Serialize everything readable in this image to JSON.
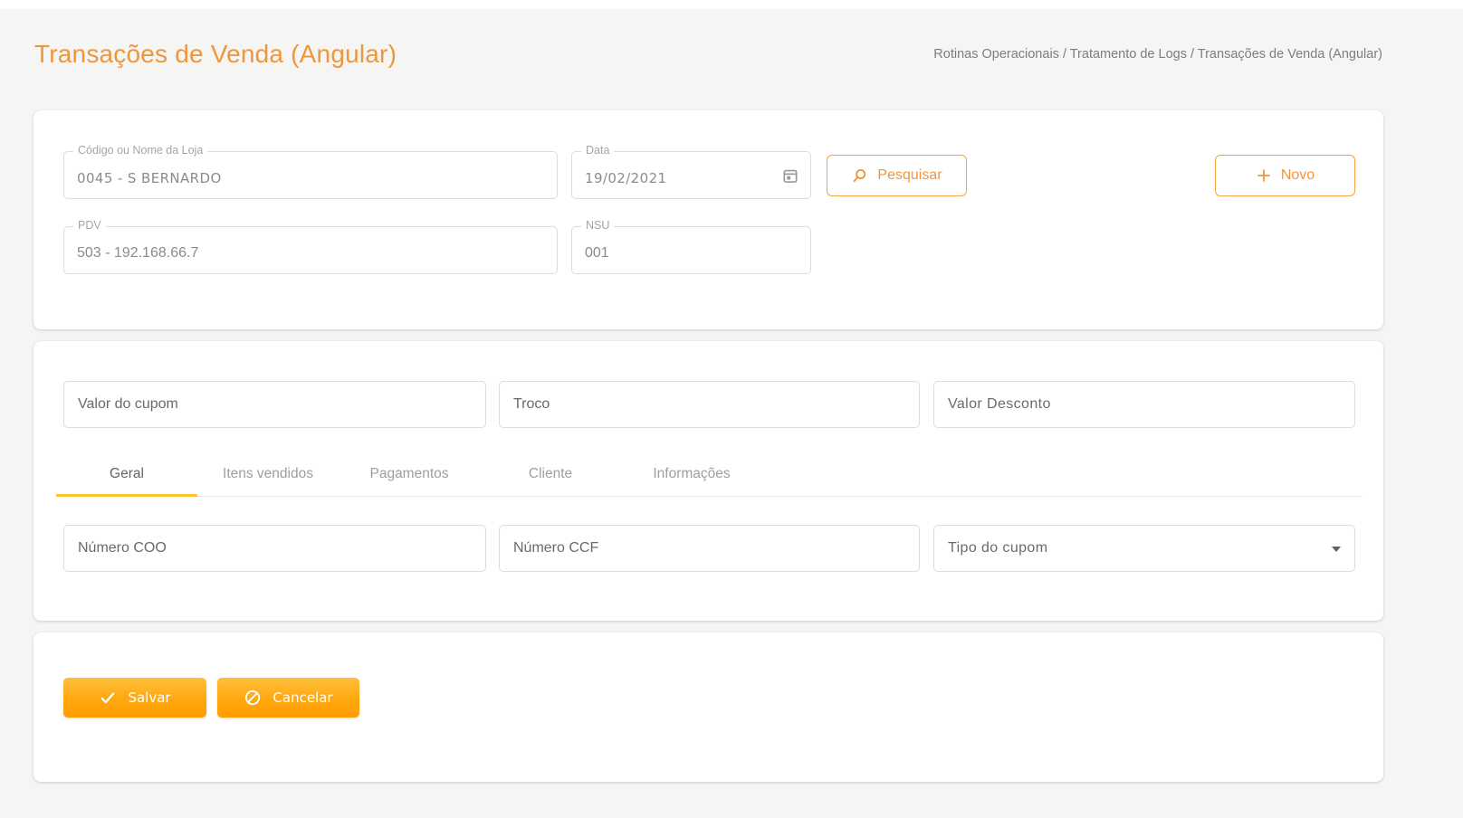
{
  "page": {
    "title": "Transações de Venda (Angular)",
    "breadcrumb": "Rotinas Operacionais / Tratamento de Logs / Transações de Venda (Angular)"
  },
  "search_card": {
    "fields": {
      "store": {
        "label": "Código ou Nome da Loja",
        "value": "0045 - S BERNARDO"
      },
      "date": {
        "label": "Data",
        "value": "19/02/2021",
        "icon": "calendar-icon"
      },
      "pdv": {
        "label": "PDV",
        "value": "503 - 192.168.66.7"
      },
      "nsu": {
        "label": "NSU",
        "value": "001"
      }
    },
    "buttons": {
      "search": {
        "label": "Pesquisar",
        "icon": "search-icon"
      },
      "new": {
        "label": "Novo",
        "icon": "plus-icon"
      }
    }
  },
  "details_card": {
    "fields": {
      "coupon_value": {
        "placeholder": "Valor do cupom"
      },
      "change": {
        "placeholder": "Troco"
      },
      "discount_value": {
        "placeholder": "Valor Desconto"
      },
      "coo_number": {
        "placeholder": "Número COO"
      },
      "ccf_number": {
        "placeholder": "Número CCF"
      },
      "coupon_type": {
        "placeholder": "Tipo do cupom",
        "icon": "caret-down-icon"
      }
    },
    "tabs": [
      {
        "label": "Geral",
        "active": true
      },
      {
        "label": "Itens vendidos",
        "active": false
      },
      {
        "label": "Pagamentos",
        "active": false
      },
      {
        "label": "Cliente",
        "active": false
      },
      {
        "label": "Informações",
        "active": false
      }
    ]
  },
  "actions_card": {
    "save": {
      "label": "Salvar",
      "icon": "check-icon"
    },
    "cancel": {
      "label": "Cancelar",
      "icon": "block-icon"
    }
  },
  "colors": {
    "accent_orange": "#f0963a",
    "outline_button_border": "#f2a43f",
    "tab_underline": "#fdc331",
    "fill_button_top": "#ffbf3d",
    "fill_button_bottom": "#ff9d00",
    "page_background": "#f5f5f3"
  }
}
